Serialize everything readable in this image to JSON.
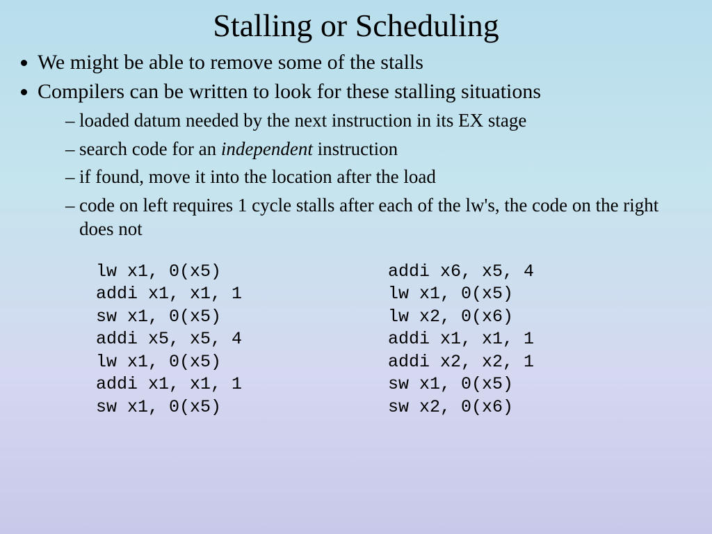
{
  "title": "Stalling or Scheduling",
  "bullets": {
    "b1": "We might be able to remove some of the stalls",
    "b2": "Compilers can be written to look for these stalling situations",
    "sub1": "loaded datum needed by the next instruction in its EX stage",
    "sub2_a": "search code for an ",
    "sub2_i": "independent",
    "sub2_b": " instruction",
    "sub3": "if found, move it into the location after the load",
    "sub4": "code on left requires 1 cycle stalls after each of the lw's, the code on the right does not"
  },
  "code_left": "lw x1, 0(x5)\naddi x1, x1, 1\nsw x1, 0(x5)\naddi x5, x5, 4\nlw x1, 0(x5)\naddi x1, x1, 1\nsw x1, 0(x5)",
  "code_right": "addi x6, x5, 4\nlw x1, 0(x5)\nlw x2, 0(x6)\naddi x1, x1, 1\naddi x2, x2, 1\nsw x1, 0(x5)\nsw x2, 0(x6)"
}
